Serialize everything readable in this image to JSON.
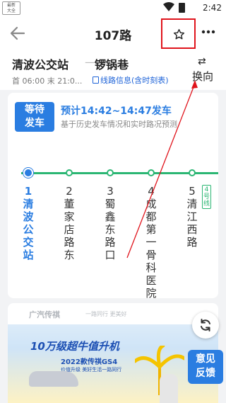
{
  "status_bar": {
    "logo_text": "最新\n大全",
    "time": "2:42"
  },
  "header": {
    "title": "107路"
  },
  "route": {
    "from_stop": "清波公交站",
    "to_stop": "锣锅巷",
    "service_time": "首 06:00 末 21:0...",
    "line_info_link": "线路信息(含时刻表)",
    "swap_label": "换向"
  },
  "arrival": {
    "badge_line1": "等待",
    "badge_line2": "发车",
    "eta": "预计14:42~14:47发车",
    "eta_note": "基于历史发车情况和实时路况预测"
  },
  "stops": [
    {
      "num": "1",
      "name": "清波公交站",
      "current": true
    },
    {
      "num": "2",
      "name": "董家店路东",
      "current": false
    },
    {
      "num": "3",
      "name": "蜀鑫东路口",
      "current": false
    },
    {
      "num": "4",
      "name": "成都第一骨科医院",
      "current": false
    },
    {
      "num": "5",
      "name": "清江西路",
      "current": false
    }
  ],
  "metro_tag": "4号线",
  "ad": {
    "brand": "广汽传祺",
    "slogan": "一路同行 更美好",
    "headline": "10万级超牛值升机",
    "model": "2022款传祺GS4",
    "sub": "价值升级  美好生活一路同行"
  },
  "feedback": {
    "line1": "意见",
    "line2": "反馈"
  },
  "colors": {
    "accent_blue": "#2a7de1",
    "route_green": "#2bb673",
    "highlight_red": "#e0141c"
  }
}
